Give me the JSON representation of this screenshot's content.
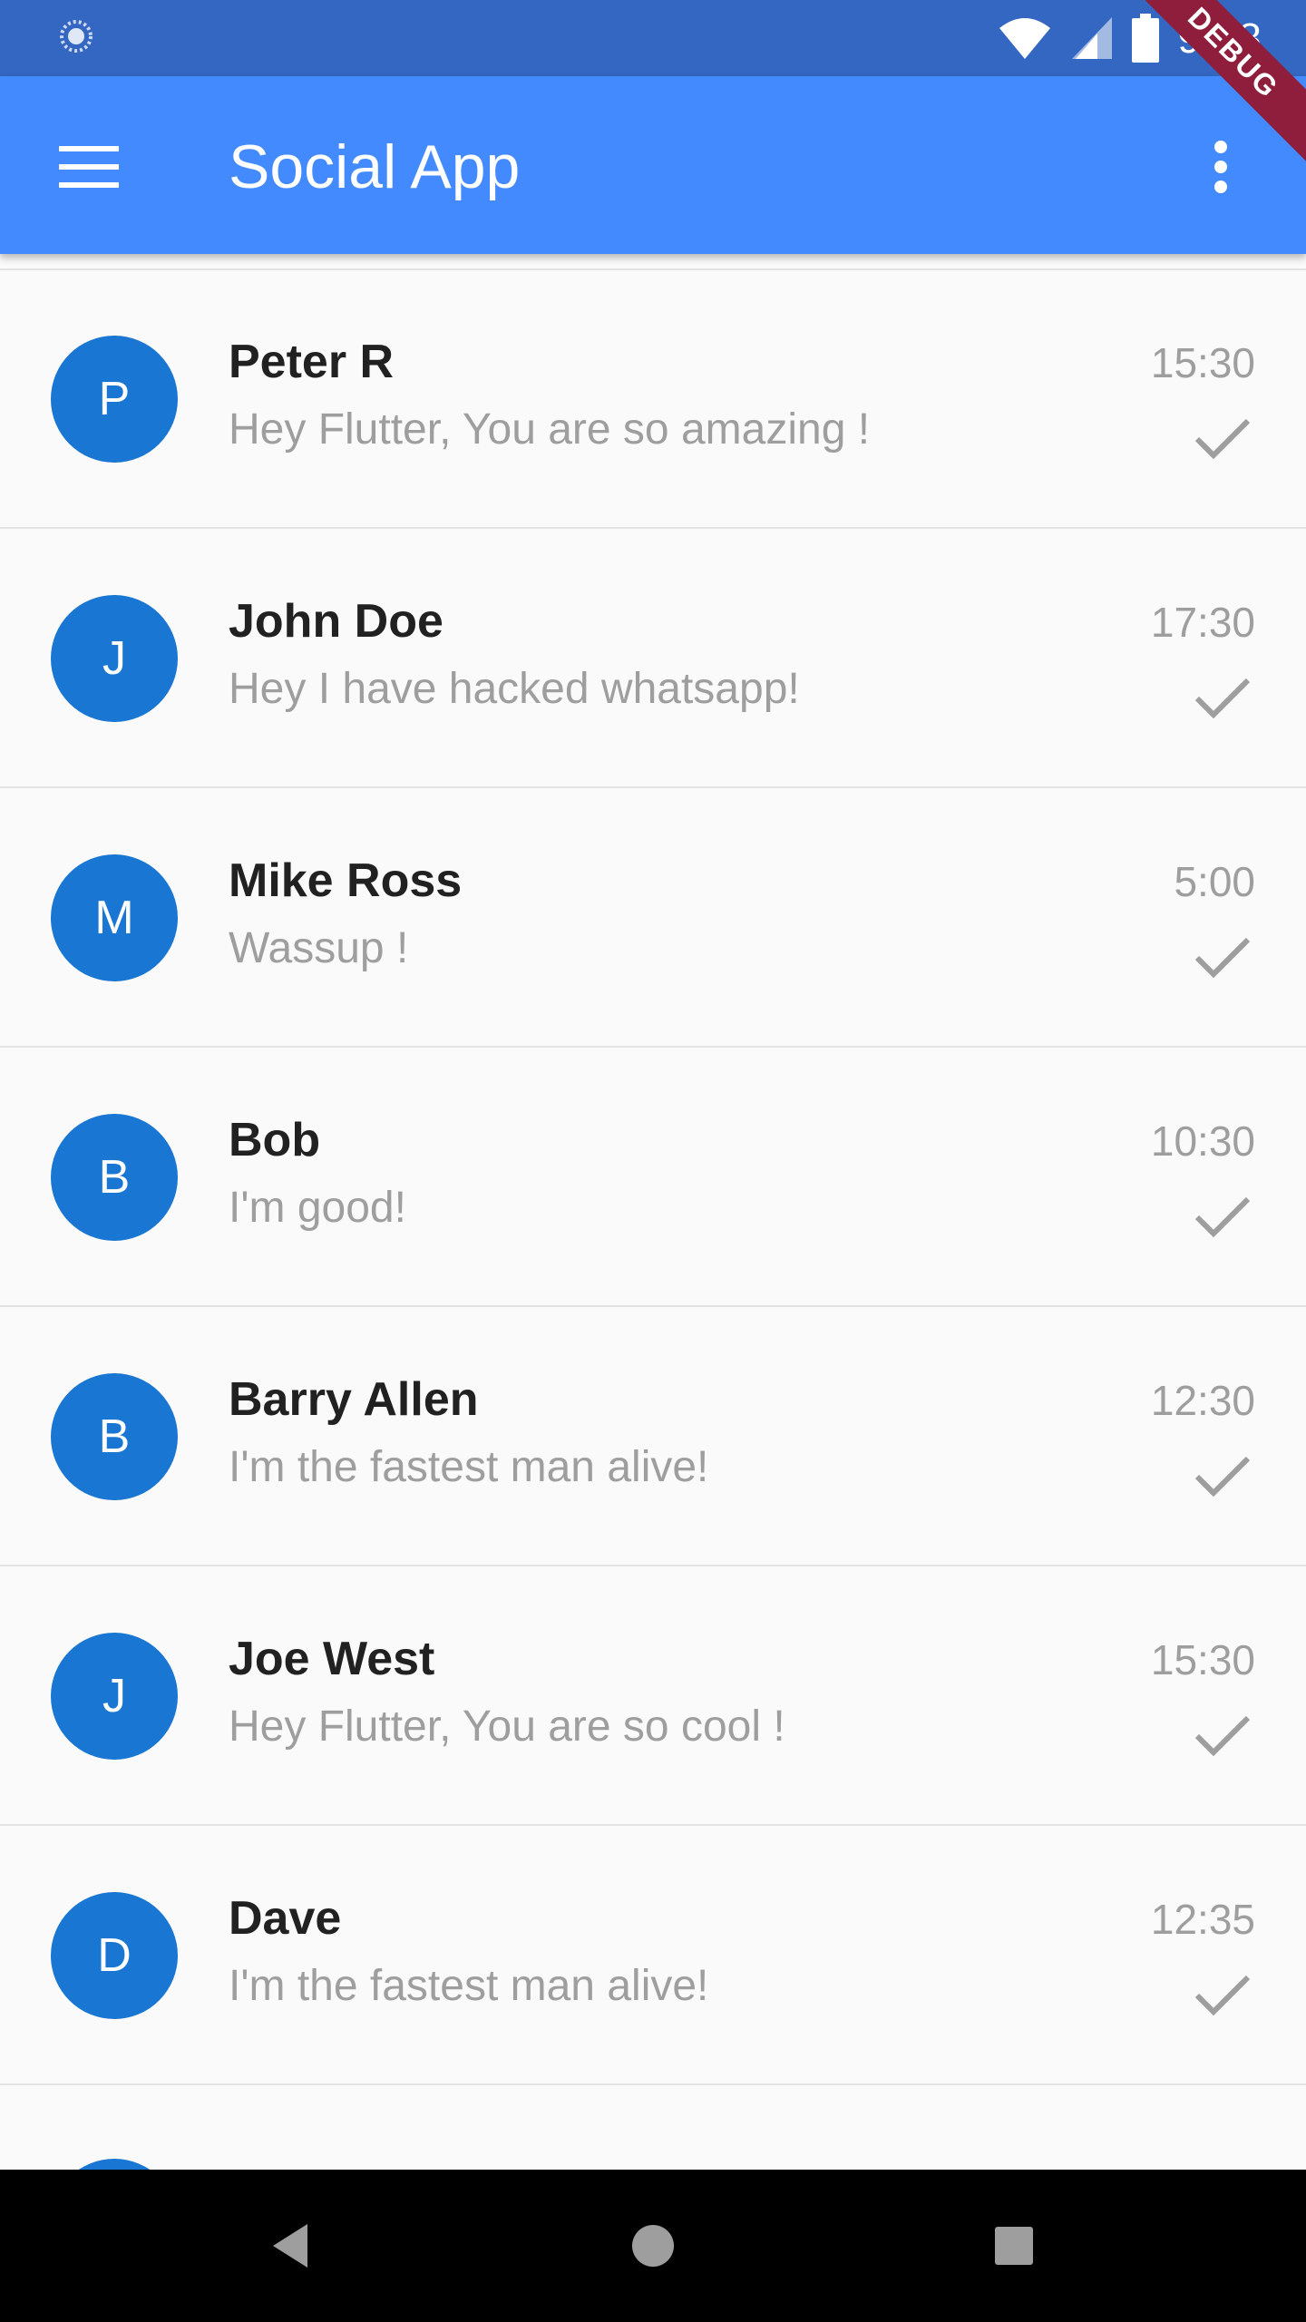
{
  "status_bar": {
    "time": "9:28",
    "icons": [
      "sync-icon",
      "wifi-icon",
      "cell-signal-icon",
      "battery-icon"
    ]
  },
  "app_bar": {
    "title": "Social App",
    "menu_icon": "menu-icon",
    "overflow_icon": "more-vert-icon",
    "background_color": "#448aff"
  },
  "debug_banner": "DEBUG",
  "colors": {
    "status_bar": "#3467c2",
    "avatar": "#1976d2",
    "debug_banner": "#8e1e3b"
  },
  "chats": [
    {
      "initial": "P",
      "name": "Peter R",
      "message": "Hey Flutter, You are so amazing !",
      "time": "15:30"
    },
    {
      "initial": "J",
      "name": "John Doe",
      "message": "Hey I have hacked whatsapp!",
      "time": "17:30"
    },
    {
      "initial": "M",
      "name": "Mike Ross",
      "message": "Wassup !",
      "time": "5:00"
    },
    {
      "initial": "B",
      "name": "Bob",
      "message": "I'm good!",
      "time": "10:30"
    },
    {
      "initial": "B",
      "name": "Barry Allen",
      "message": "I'm the fastest man alive!",
      "time": "12:30"
    },
    {
      "initial": "J",
      "name": "Joe West",
      "message": "Hey Flutter, You are so cool !",
      "time": "15:30"
    },
    {
      "initial": "D",
      "name": "Dave",
      "message": "I'm the fastest man alive!",
      "time": "12:35"
    }
  ],
  "nav_bar": {
    "buttons": [
      "back-icon",
      "home-icon",
      "recents-icon"
    ]
  }
}
